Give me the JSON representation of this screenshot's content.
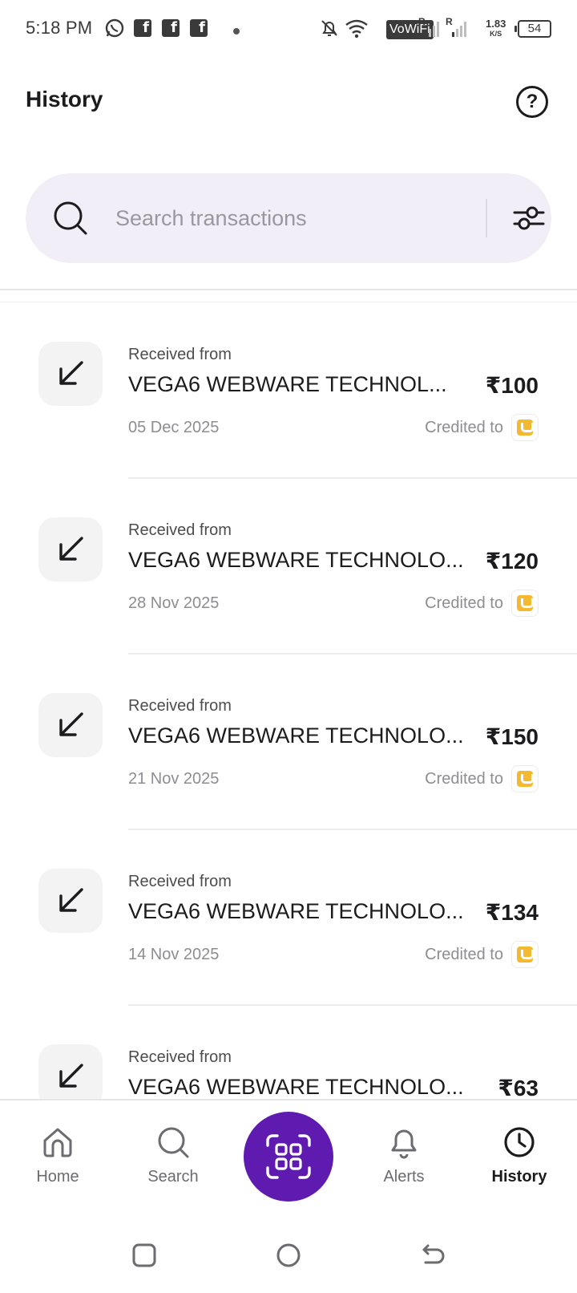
{
  "status_bar": {
    "time": "5:18 PM",
    "network_type": "VoWiFi",
    "speed_value": "1.83",
    "speed_unit": "K/S",
    "battery": "54",
    "sim_label_1": "R",
    "sim_label_2": "R"
  },
  "header": {
    "title": "History",
    "help_symbol": "?"
  },
  "search": {
    "placeholder": "Search transactions",
    "value": ""
  },
  "transactions": [
    {
      "label": "Received from",
      "name": "VEGA6 WEBWARE TECHNOL...",
      "amount": "₹100",
      "date": "05 Dec 2025",
      "credited": "Credited to"
    },
    {
      "label": "Received from",
      "name": "VEGA6 WEBWARE TECHNOLO...",
      "amount": "₹120",
      "date": "28 Nov 2025",
      "credited": "Credited to"
    },
    {
      "label": "Received from",
      "name": "VEGA6 WEBWARE TECHNOLO...",
      "amount": "₹150",
      "date": "21 Nov 2025",
      "credited": "Credited to"
    },
    {
      "label": "Received from",
      "name": "VEGA6 WEBWARE TECHNOLO...",
      "amount": "₹134",
      "date": "14 Nov 2025",
      "credited": "Credited to"
    },
    {
      "label": "Received from",
      "name": "VEGA6 WEBWARE TECHNOLO...",
      "amount": "₹63",
      "date": "",
      "credited": ""
    }
  ],
  "bottom_nav": {
    "items": [
      {
        "label": "Home",
        "icon": "home-icon"
      },
      {
        "label": "Search",
        "icon": "search-icon"
      },
      {
        "label": "",
        "icon": "qr-scan-icon"
      },
      {
        "label": "Alerts",
        "icon": "bell-icon"
      },
      {
        "label": "History",
        "icon": "clock-icon"
      }
    ],
    "active": "History"
  },
  "colors": {
    "accent": "#5f1bb0",
    "search_bg": "#f1eef8",
    "bank_badge": "#f2b931"
  }
}
